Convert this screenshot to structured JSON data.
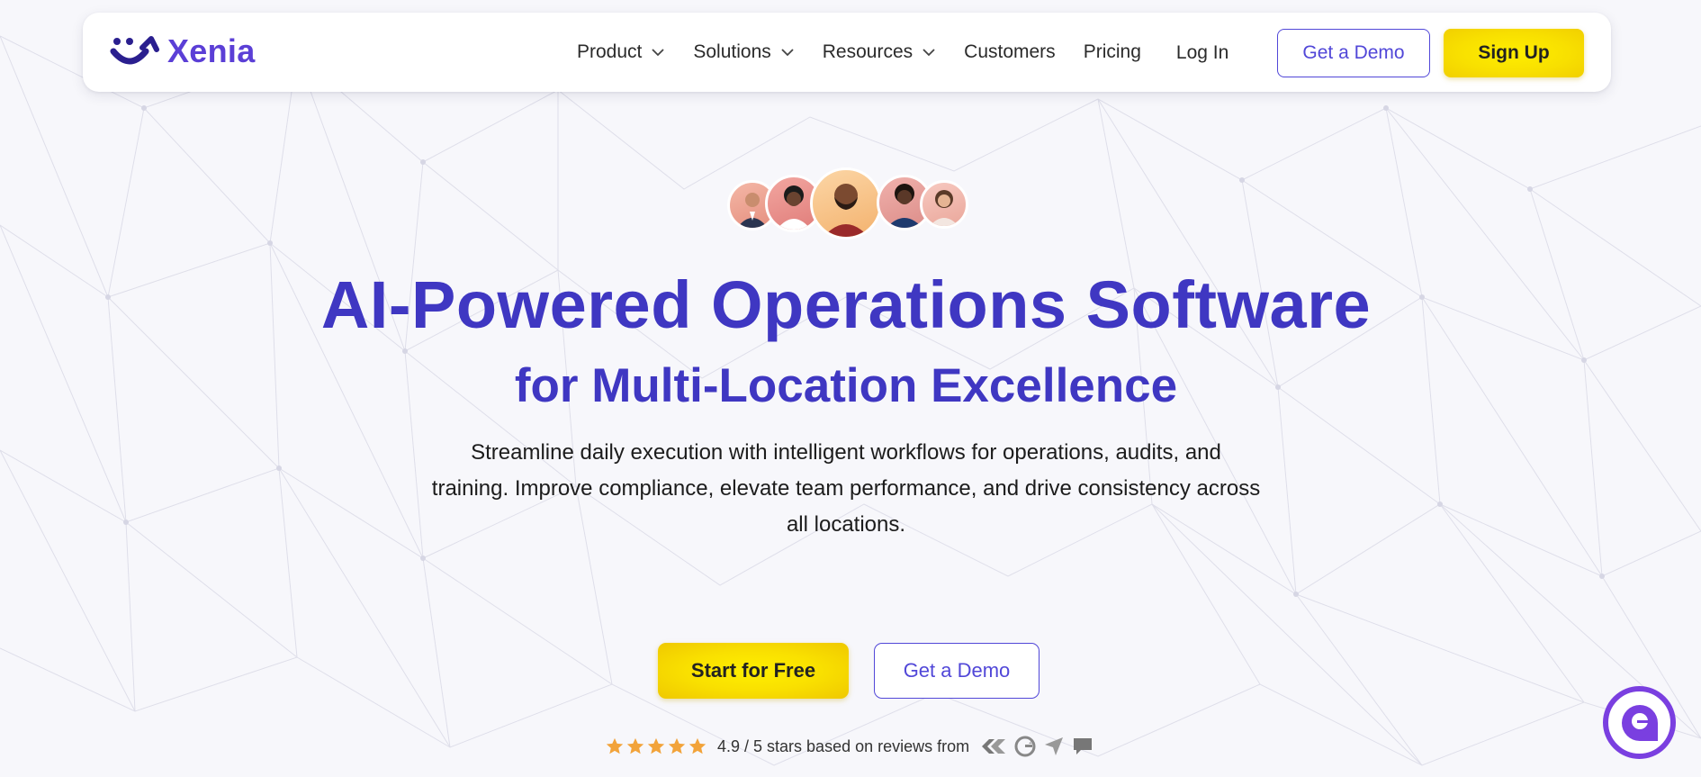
{
  "brand": {
    "name": "Xenia",
    "color": "#5b3fd6"
  },
  "nav": {
    "items": [
      {
        "label": "Product",
        "has_dropdown": true
      },
      {
        "label": "Solutions",
        "has_dropdown": true
      },
      {
        "label": "Resources",
        "has_dropdown": true
      },
      {
        "label": "Customers",
        "has_dropdown": false
      },
      {
        "label": "Pricing",
        "has_dropdown": false
      }
    ],
    "login_label": "Log In",
    "demo_label": "Get a Demo",
    "signup_label": "Sign Up"
  },
  "hero": {
    "title": "AI-Powered Operations Software",
    "subtitle": "for Multi-Location Excellence",
    "description_lines": [
      "Streamline daily execution with intelligent workflows for operations, audits, and",
      "training. Improve compliance, elevate team performance, and drive consistency across",
      "all locations."
    ],
    "start_label": "Start for Free",
    "demo_label": "Get a Demo"
  },
  "rating": {
    "stars": 5,
    "text": "4.9 / 5 stars based on reviews from",
    "review_sources": [
      "capterra-icon",
      "g2-icon",
      "getapp-icon",
      "software-advice-icon"
    ]
  },
  "colors": {
    "primary": "#3f37c2",
    "accent_yellow": "#f9e000",
    "outline_purple": "#5147d8",
    "chat_purple": "#7a3fe0"
  }
}
